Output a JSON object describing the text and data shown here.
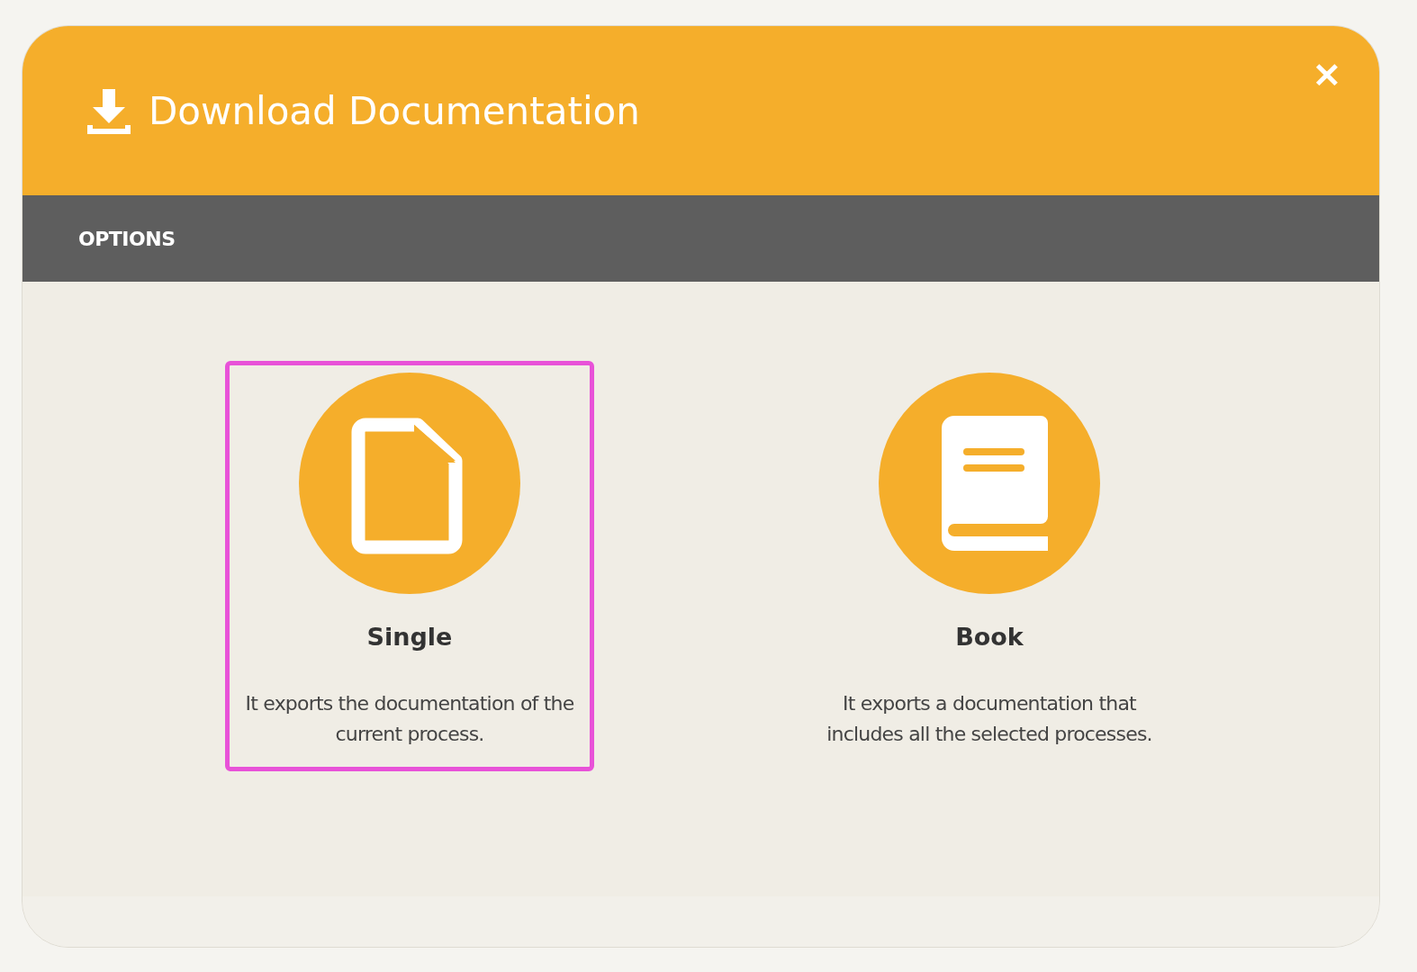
{
  "dialog": {
    "title": "Download Documentation",
    "close": "✕"
  },
  "section": {
    "title": "OPTIONS"
  },
  "options": [
    {
      "kind": "single",
      "label": "Single",
      "description": "It exports the documentation of the current process.",
      "selected": true
    },
    {
      "kind": "book",
      "label": "Book",
      "description": "It exports a documentation that includes all the selected processes.",
      "selected": false
    }
  ]
}
